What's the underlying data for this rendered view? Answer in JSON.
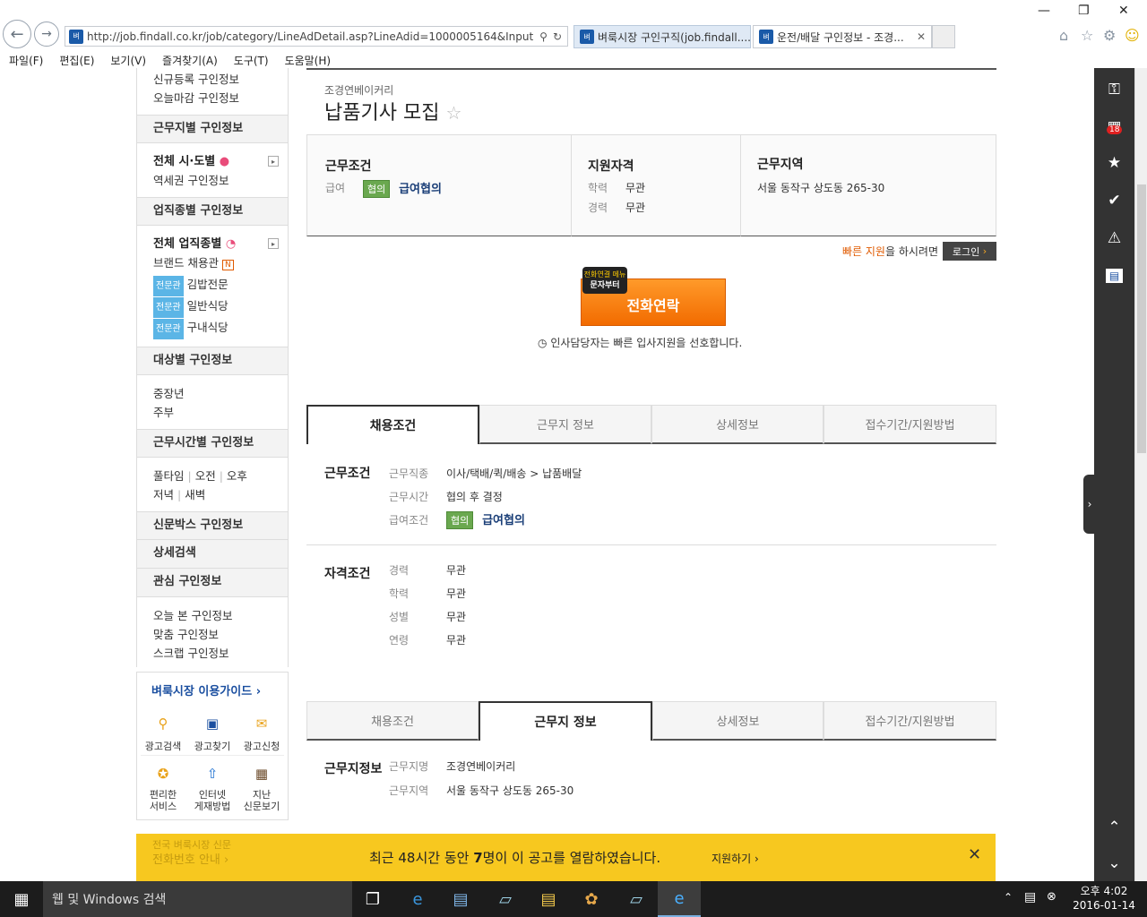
{
  "browser": {
    "url": "http://job.findall.co.kr/job/category/LineAdDetail.asp?LineAdid=1000005164&InputBranc",
    "tabs": [
      {
        "label": "벼룩시장 구인구직(job.findall...."
      },
      {
        "label": "운전/배달 구인정보 - 조경..."
      }
    ],
    "menu": [
      "파일(F)",
      "편집(E)",
      "보기(V)",
      "즐겨찾기(A)",
      "도구(T)",
      "도움말(H)"
    ]
  },
  "sidebar": {
    "top_links": [
      "신규등록 구인정보",
      "오늘마감 구인정보"
    ],
    "region_head": "근무지별 구인정보",
    "region_all": "전체 시·도별",
    "region_subway": "역세권 구인정보",
    "industry_head": "업직종별 구인정보",
    "industry_all": "전체 업직종별",
    "brand": "브랜드 채용관",
    "brand_badge": "N",
    "pro_badge": "전문관",
    "pro_items": [
      "김밥전문",
      "일반식당",
      "구내식당"
    ],
    "target_head": "대상별 구인정보",
    "target_items": [
      "중장년",
      "주부"
    ],
    "time_head": "근무시간별 구인정보",
    "time_row1": [
      "풀타임",
      "오전",
      "오후"
    ],
    "time_row2": [
      "저녁",
      "새벽"
    ],
    "newspaper_head": "신문박스 구인정보",
    "detail_head": "상세검색",
    "interest_head": "관심 구인정보",
    "interest_items": [
      "오늘 본 구인정보",
      "맞춤 구인정보",
      "스크랩 구인정보"
    ],
    "guide_title": "벼룩시장 이용가이드",
    "guide_items": [
      {
        "label": "광고검색"
      },
      {
        "label": "광고찾기"
      },
      {
        "label": "광고신청"
      },
      {
        "label": "편리한\n서비스"
      },
      {
        "label": "인터넷\n게재방법"
      },
      {
        "label": "지난\n신문보기"
      }
    ],
    "phone_guide_1": "전국 벼룩시장 신문",
    "phone_guide_2": "전화번호 안내"
  },
  "job": {
    "company": "조경연베이커리",
    "title": "납품기사 모집",
    "conditions_title": "근무조건",
    "salary_label": "급여",
    "salary_tag": "협의",
    "salary_value": "급여협의",
    "qual_title": "지원자격",
    "edu_label": "학력",
    "edu_value": "무관",
    "exp_label": "경력",
    "exp_value": "무관",
    "area_title": "근무지역",
    "area_value": "서울 동작구 상도동 265-30",
    "quick_apply": "빠른 지원",
    "quick_apply_suffix": "을 하시려면",
    "login_btn": "로그인",
    "phone_badge_1": "전화연결 메뉴",
    "phone_badge_2": "문자부터",
    "phone_btn": "전화연락",
    "hr_note": "인사담당자는 빠른 입사지원을 선호합니다."
  },
  "tabs": [
    "채용조건",
    "근무지 정보",
    "상세정보",
    "접수기간/지원방법"
  ],
  "hire_conditions": {
    "work_title": "근무조건",
    "rows": [
      {
        "label": "근무직종",
        "value": "이사/택배/퀵/배송 > 납품배달"
      },
      {
        "label": "근무시간",
        "value": "협의 후 결정"
      },
      {
        "label": "급여조건",
        "tag": "협의",
        "value": "급여협의"
      }
    ],
    "qual_title": "자격조건",
    "qual_rows": [
      {
        "label": "경력",
        "value": "무관"
      },
      {
        "label": "학력",
        "value": "무관"
      },
      {
        "label": "성별",
        "value": "무관"
      },
      {
        "label": "연령",
        "value": "무관"
      }
    ]
  },
  "workplace": {
    "title": "근무지정보",
    "rows": [
      {
        "label": "근무지명",
        "value": "조경연베이커리"
      },
      {
        "label": "근무지역",
        "value": "서울 동작구 상도동 265-30"
      }
    ]
  },
  "banner": {
    "text_pre": "최근 48시간 동안 ",
    "count": "7",
    "text_post": "명이 이 공고를 열람하였습니다.",
    "apply": "지원하기"
  },
  "right_toolbar": {
    "badge_count": "18"
  },
  "taskbar": {
    "search": "웹 및 Windows 검색",
    "time": "오후 4:02",
    "date": "2016-01-14"
  }
}
